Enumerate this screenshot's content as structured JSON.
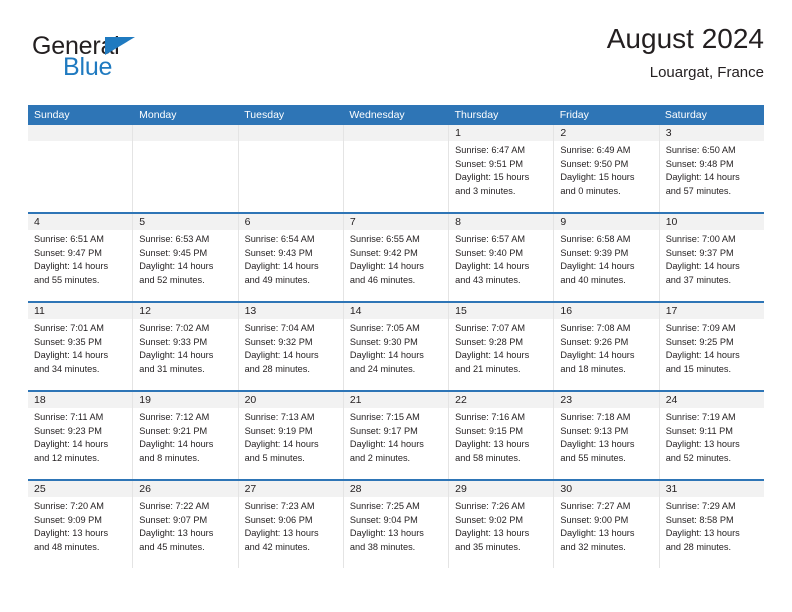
{
  "brand": {
    "word_general": "General",
    "word_blue": "Blue",
    "triangle_color": "#1f7ac0"
  },
  "header": {
    "title": "August 2024",
    "subtitle": "Louargat, France"
  },
  "colors": {
    "header_blue": "#2e75b6",
    "row_divider_blue": "#2e75b6",
    "day_band_gray": "#f2f2f2",
    "text": "#231f20"
  },
  "weekdays": [
    "Sunday",
    "Monday",
    "Tuesday",
    "Wednesday",
    "Thursday",
    "Friday",
    "Saturday"
  ],
  "weeks": [
    [
      {
        "day": "",
        "sunrise": "",
        "sunset": "",
        "daylight_1": "",
        "daylight_2": ""
      },
      {
        "day": "",
        "sunrise": "",
        "sunset": "",
        "daylight_1": "",
        "daylight_2": ""
      },
      {
        "day": "",
        "sunrise": "",
        "sunset": "",
        "daylight_1": "",
        "daylight_2": ""
      },
      {
        "day": "",
        "sunrise": "",
        "sunset": "",
        "daylight_1": "",
        "daylight_2": ""
      },
      {
        "day": "1",
        "sunrise": "Sunrise: 6:47 AM",
        "sunset": "Sunset: 9:51 PM",
        "daylight_1": "Daylight: 15 hours",
        "daylight_2": "and 3 minutes."
      },
      {
        "day": "2",
        "sunrise": "Sunrise: 6:49 AM",
        "sunset": "Sunset: 9:50 PM",
        "daylight_1": "Daylight: 15 hours",
        "daylight_2": "and 0 minutes."
      },
      {
        "day": "3",
        "sunrise": "Sunrise: 6:50 AM",
        "sunset": "Sunset: 9:48 PM",
        "daylight_1": "Daylight: 14 hours",
        "daylight_2": "and 57 minutes."
      }
    ],
    [
      {
        "day": "4",
        "sunrise": "Sunrise: 6:51 AM",
        "sunset": "Sunset: 9:47 PM",
        "daylight_1": "Daylight: 14 hours",
        "daylight_2": "and 55 minutes."
      },
      {
        "day": "5",
        "sunrise": "Sunrise: 6:53 AM",
        "sunset": "Sunset: 9:45 PM",
        "daylight_1": "Daylight: 14 hours",
        "daylight_2": "and 52 minutes."
      },
      {
        "day": "6",
        "sunrise": "Sunrise: 6:54 AM",
        "sunset": "Sunset: 9:43 PM",
        "daylight_1": "Daylight: 14 hours",
        "daylight_2": "and 49 minutes."
      },
      {
        "day": "7",
        "sunrise": "Sunrise: 6:55 AM",
        "sunset": "Sunset: 9:42 PM",
        "daylight_1": "Daylight: 14 hours",
        "daylight_2": "and 46 minutes."
      },
      {
        "day": "8",
        "sunrise": "Sunrise: 6:57 AM",
        "sunset": "Sunset: 9:40 PM",
        "daylight_1": "Daylight: 14 hours",
        "daylight_2": "and 43 minutes."
      },
      {
        "day": "9",
        "sunrise": "Sunrise: 6:58 AM",
        "sunset": "Sunset: 9:39 PM",
        "daylight_1": "Daylight: 14 hours",
        "daylight_2": "and 40 minutes."
      },
      {
        "day": "10",
        "sunrise": "Sunrise: 7:00 AM",
        "sunset": "Sunset: 9:37 PM",
        "daylight_1": "Daylight: 14 hours",
        "daylight_2": "and 37 minutes."
      }
    ],
    [
      {
        "day": "11",
        "sunrise": "Sunrise: 7:01 AM",
        "sunset": "Sunset: 9:35 PM",
        "daylight_1": "Daylight: 14 hours",
        "daylight_2": "and 34 minutes."
      },
      {
        "day": "12",
        "sunrise": "Sunrise: 7:02 AM",
        "sunset": "Sunset: 9:33 PM",
        "daylight_1": "Daylight: 14 hours",
        "daylight_2": "and 31 minutes."
      },
      {
        "day": "13",
        "sunrise": "Sunrise: 7:04 AM",
        "sunset": "Sunset: 9:32 PM",
        "daylight_1": "Daylight: 14 hours",
        "daylight_2": "and 28 minutes."
      },
      {
        "day": "14",
        "sunrise": "Sunrise: 7:05 AM",
        "sunset": "Sunset: 9:30 PM",
        "daylight_1": "Daylight: 14 hours",
        "daylight_2": "and 24 minutes."
      },
      {
        "day": "15",
        "sunrise": "Sunrise: 7:07 AM",
        "sunset": "Sunset: 9:28 PM",
        "daylight_1": "Daylight: 14 hours",
        "daylight_2": "and 21 minutes."
      },
      {
        "day": "16",
        "sunrise": "Sunrise: 7:08 AM",
        "sunset": "Sunset: 9:26 PM",
        "daylight_1": "Daylight: 14 hours",
        "daylight_2": "and 18 minutes."
      },
      {
        "day": "17",
        "sunrise": "Sunrise: 7:09 AM",
        "sunset": "Sunset: 9:25 PM",
        "daylight_1": "Daylight: 14 hours",
        "daylight_2": "and 15 minutes."
      }
    ],
    [
      {
        "day": "18",
        "sunrise": "Sunrise: 7:11 AM",
        "sunset": "Sunset: 9:23 PM",
        "daylight_1": "Daylight: 14 hours",
        "daylight_2": "and 12 minutes."
      },
      {
        "day": "19",
        "sunrise": "Sunrise: 7:12 AM",
        "sunset": "Sunset: 9:21 PM",
        "daylight_1": "Daylight: 14 hours",
        "daylight_2": "and 8 minutes."
      },
      {
        "day": "20",
        "sunrise": "Sunrise: 7:13 AM",
        "sunset": "Sunset: 9:19 PM",
        "daylight_1": "Daylight: 14 hours",
        "daylight_2": "and 5 minutes."
      },
      {
        "day": "21",
        "sunrise": "Sunrise: 7:15 AM",
        "sunset": "Sunset: 9:17 PM",
        "daylight_1": "Daylight: 14 hours",
        "daylight_2": "and 2 minutes."
      },
      {
        "day": "22",
        "sunrise": "Sunrise: 7:16 AM",
        "sunset": "Sunset: 9:15 PM",
        "daylight_1": "Daylight: 13 hours",
        "daylight_2": "and 58 minutes."
      },
      {
        "day": "23",
        "sunrise": "Sunrise: 7:18 AM",
        "sunset": "Sunset: 9:13 PM",
        "daylight_1": "Daylight: 13 hours",
        "daylight_2": "and 55 minutes."
      },
      {
        "day": "24",
        "sunrise": "Sunrise: 7:19 AM",
        "sunset": "Sunset: 9:11 PM",
        "daylight_1": "Daylight: 13 hours",
        "daylight_2": "and 52 minutes."
      }
    ],
    [
      {
        "day": "25",
        "sunrise": "Sunrise: 7:20 AM",
        "sunset": "Sunset: 9:09 PM",
        "daylight_1": "Daylight: 13 hours",
        "daylight_2": "and 48 minutes."
      },
      {
        "day": "26",
        "sunrise": "Sunrise: 7:22 AM",
        "sunset": "Sunset: 9:07 PM",
        "daylight_1": "Daylight: 13 hours",
        "daylight_2": "and 45 minutes."
      },
      {
        "day": "27",
        "sunrise": "Sunrise: 7:23 AM",
        "sunset": "Sunset: 9:06 PM",
        "daylight_1": "Daylight: 13 hours",
        "daylight_2": "and 42 minutes."
      },
      {
        "day": "28",
        "sunrise": "Sunrise: 7:25 AM",
        "sunset": "Sunset: 9:04 PM",
        "daylight_1": "Daylight: 13 hours",
        "daylight_2": "and 38 minutes."
      },
      {
        "day": "29",
        "sunrise": "Sunrise: 7:26 AM",
        "sunset": "Sunset: 9:02 PM",
        "daylight_1": "Daylight: 13 hours",
        "daylight_2": "and 35 minutes."
      },
      {
        "day": "30",
        "sunrise": "Sunrise: 7:27 AM",
        "sunset": "Sunset: 9:00 PM",
        "daylight_1": "Daylight: 13 hours",
        "daylight_2": "and 32 minutes."
      },
      {
        "day": "31",
        "sunrise": "Sunrise: 7:29 AM",
        "sunset": "Sunset: 8:58 PM",
        "daylight_1": "Daylight: 13 hours",
        "daylight_2": "and 28 minutes."
      }
    ]
  ]
}
